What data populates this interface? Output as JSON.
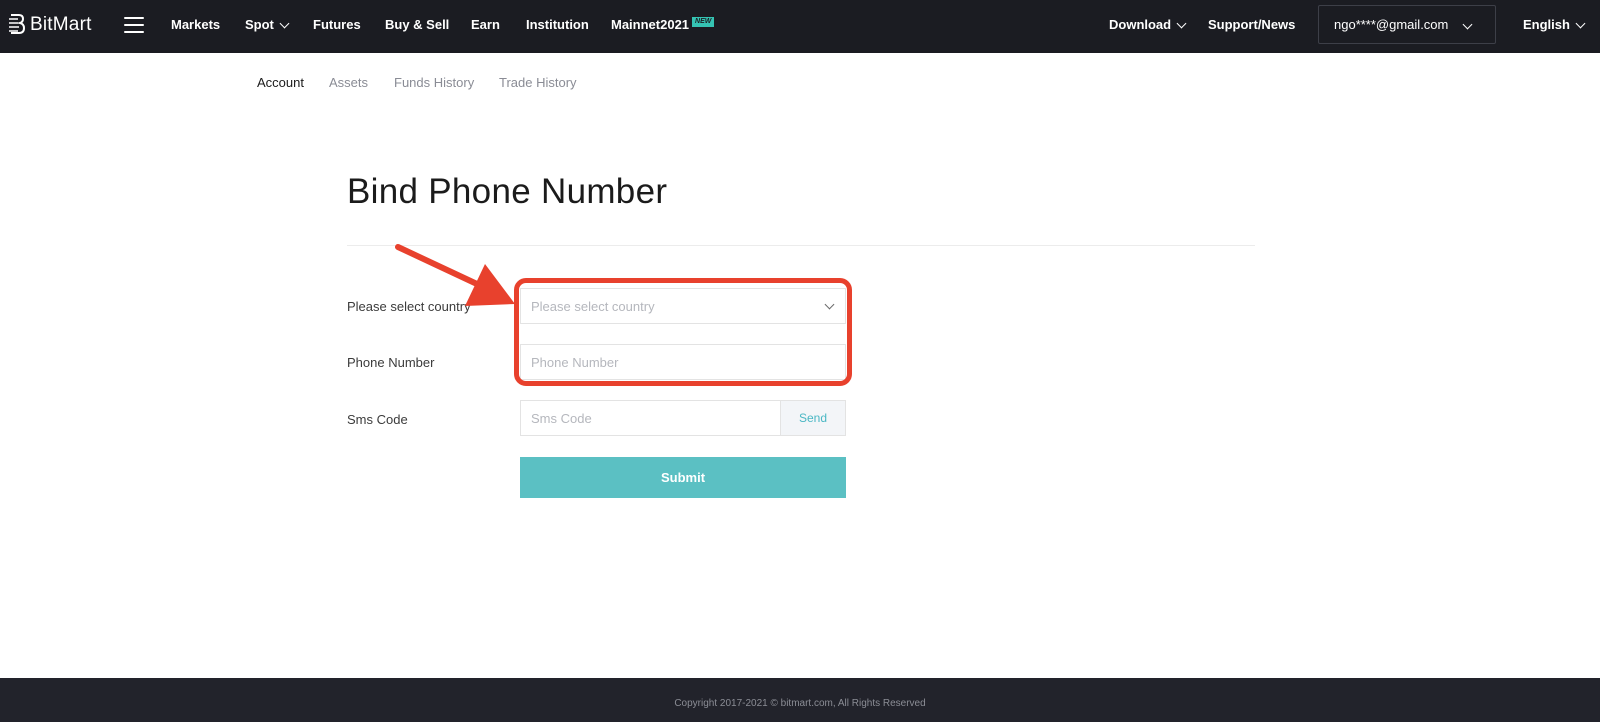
{
  "brand": {
    "name": "BitMart"
  },
  "topnav": {
    "items": [
      {
        "label": "Markets"
      },
      {
        "label": "Spot"
      },
      {
        "label": "Futures"
      },
      {
        "label": "Buy & Sell"
      },
      {
        "label": "Earn"
      },
      {
        "label": "Institution"
      },
      {
        "label": "Mainnet2021",
        "badge": "NEW"
      }
    ],
    "download": "Download",
    "support": "Support/News",
    "account_email": "ngo****@gmail.com",
    "language": "English"
  },
  "subnav": {
    "tabs": [
      {
        "label": "Account",
        "active": true
      },
      {
        "label": "Assets"
      },
      {
        "label": "Funds History"
      },
      {
        "label": "Trade History"
      }
    ]
  },
  "form": {
    "title": "Bind Phone Number",
    "country": {
      "label": "Please select country",
      "placeholder": "Please select country"
    },
    "phone": {
      "label": "Phone Number",
      "placeholder": "Phone Number"
    },
    "sms": {
      "label": "Sms Code",
      "placeholder": "Sms Code",
      "send_label": "Send"
    },
    "submit_label": "Submit"
  },
  "footer": {
    "copyright": "Copyright 2017-2021 © bitmart.com, All Rights Reserved"
  },
  "colors": {
    "nav_bg": "#1b1c22",
    "accent": "#5bc0c3",
    "annotation": "#e8412d",
    "footer_bg": "#22232b"
  },
  "icons": [
    "bitmart-logo-icon",
    "menu-icon",
    "chevron-down-icon",
    "arrow-annotation-icon"
  ]
}
